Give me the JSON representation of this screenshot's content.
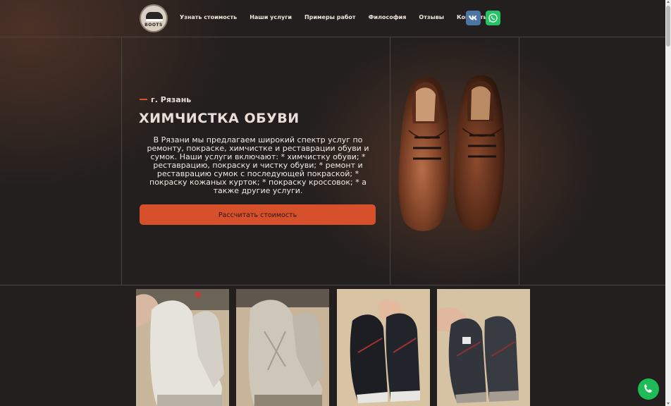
{
  "header": {
    "logo_text": "BOOTS",
    "nav": [
      {
        "label": "Узнать стоимость"
      },
      {
        "label": "Наши услуги"
      },
      {
        "label": "Примеры работ"
      },
      {
        "label": "Философия"
      },
      {
        "label": "Отзывы"
      },
      {
        "label": "Контакты"
      }
    ],
    "social": {
      "vk_icon": "vk-icon",
      "whatsapp_icon": "whatsapp-icon"
    }
  },
  "hero": {
    "city": "г. Рязань",
    "title": "ХИМЧИСТКА ОБУВИ",
    "description": "В Рязани мы предлагаем широкий спектр услуг по ремонту, покраске, химчистке и реставрации обуви и сумок. Наши услуги включают: * химчистку обуви; * реставрацию, покраску и чистку обуви; * ремонт и реставрацию сумок с последующей покраской; * покраску кожаных курток; * покраску кроссовок; * а также другие услуги.",
    "cta_label": "Рассчитать стоимость"
  },
  "gallery": {
    "photos": [
      "white-boots-after",
      "white-boots-before",
      "sneakers-after",
      "sneakers-before"
    ]
  },
  "colors": {
    "accent": "#d6502b",
    "background": "#231f1e",
    "vk": "#4c75a3",
    "whatsapp": "#25c365"
  }
}
